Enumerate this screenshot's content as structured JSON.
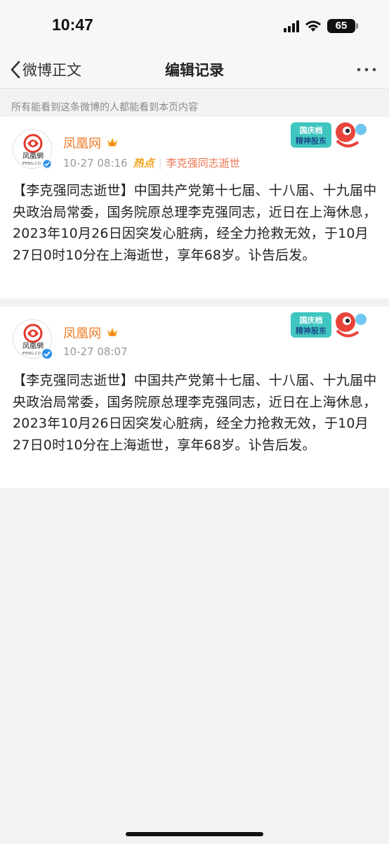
{
  "status_bar": {
    "time": "10:47",
    "battery": "65",
    "icons": [
      "cellular-signal-icon",
      "wifi-icon",
      "battery-icon"
    ]
  },
  "nav": {
    "back_label": "微博正文",
    "title": "编辑记录",
    "more_icon": "more-dots-icon"
  },
  "notice": "所有能看到这条微博的人都能看到本页内容",
  "posts": [
    {
      "author": "凤凰网",
      "avatar_text": "凤凰網",
      "avatar_sub": "IFENG.COM",
      "time": "10-27 08:16",
      "hot_tag": "热点",
      "topic": "李克强同志逝世",
      "banner_text": "国庆档 精神股东",
      "text": "【李克强同志逝世】中国共产党第十七届、十八届、十九届中央政治局常委，国务院原总理李克强同志，近日在上海休息，2023年10月26日因突发心脏病，经全力抢救无效，于10月27日0时10分在上海逝世，享年68岁。讣告后发。"
    },
    {
      "author": "凤凰网",
      "avatar_text": "凤凰網",
      "avatar_sub": "IFENG.COM",
      "time": "10-27 08:07",
      "banner_text": "国庆档 精神股东",
      "text": "【李克强同志逝世】中国共产党第十七届、十八届、十九届中央政治局常委，国务院原总理李克强同志，近日在上海休息，2023年10月26日因突发心脏病，经全力抢救无效，于10月27日0时10分在上海逝世，享年68岁。讣告后发。"
    }
  ],
  "colors": {
    "author": "#f07b26",
    "topic": "#eb7350",
    "hot": "#f3a11a",
    "verify": "#2c8fe8",
    "background": "#f2f2f2"
  }
}
